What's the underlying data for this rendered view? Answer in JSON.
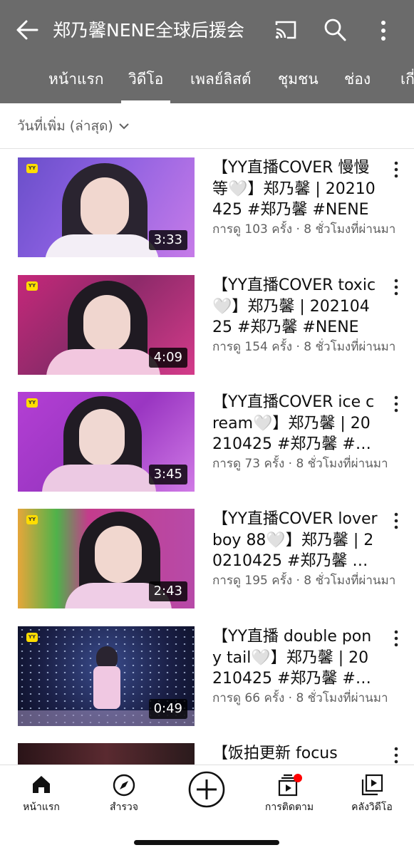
{
  "header": {
    "channel_title": "郑乃馨NENE全球后援会"
  },
  "tabs": [
    {
      "label": "หน้าแรก"
    },
    {
      "label": "วิดีโอ"
    },
    {
      "label": "เพลย์ลิสต์"
    },
    {
      "label": "ชุมชน"
    },
    {
      "label": "ช่อง"
    },
    {
      "label": "เกี่ยวกับ"
    }
  ],
  "sort": {
    "label": "วันที่เพิ่ม (ล่าสุด)"
  },
  "videos": [
    {
      "title": "【YY直播COVER 慢慢等🤍】郑乃馨 | 20210425 #郑乃馨 #NENE",
      "meta": "การดู 103 ครั้ง · 8 ชั่วโมงที่ผ่านมา",
      "duration": "3:33"
    },
    {
      "title": "【YY直播COVER toxic🤍】郑乃馨 | 20210425 #郑乃馨 #NENE",
      "meta": "การดู 154 ครั้ง · 8 ชั่วโมงที่ผ่านมา",
      "duration": "4:09"
    },
    {
      "title": "【YY直播COVER ice cream🤍】郑乃馨 | 20210425 #郑乃馨 #NENE",
      "meta": "การดู 73 ครั้ง · 8 ชั่วโมงที่ผ่านมา",
      "duration": "3:45"
    },
    {
      "title": "【YY直播COVER lover boy 88🤍】郑乃馨 | 20210425 #郑乃馨 #NENE",
      "meta": "การดู 195 ครั้ง · 8 ชั่วโมงที่ผ่านมา",
      "duration": "2:43"
    },
    {
      "title": "【YY直播 double pony tail🤍】郑乃馨 | 20210425 #郑乃馨 #NENE",
      "meta": "การดู 66 ครั้ง · 8 ชั่วโมงที่ผ่านมา",
      "duration": "0:49"
    },
    {
      "title": "【饭拍更新 focus"
    }
  ],
  "bottom_nav": [
    {
      "label": "หน้าแรก",
      "icon": "home-icon"
    },
    {
      "label": "สำรวจ",
      "icon": "explore-icon"
    },
    {
      "label": "",
      "icon": "create-icon"
    },
    {
      "label": "การติดตาม",
      "icon": "subscriptions-icon"
    },
    {
      "label": "คลังวิดีโอ",
      "icon": "library-icon"
    }
  ],
  "colors": {
    "appbar": "#6b6b6b",
    "notification_dot": "#ff0000"
  }
}
